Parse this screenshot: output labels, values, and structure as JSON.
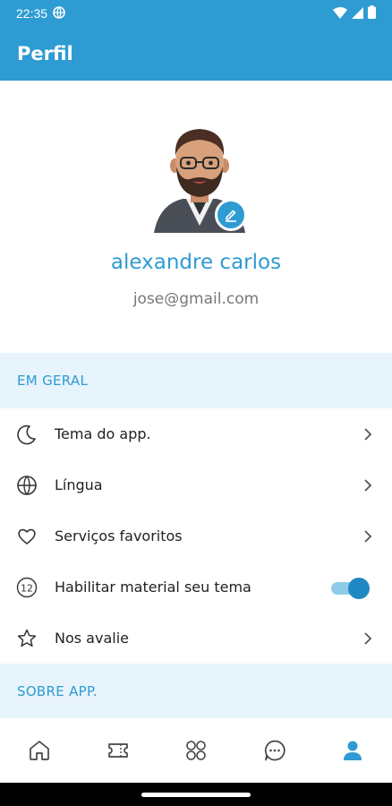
{
  "status_bar": {
    "time": "22:35",
    "icons": [
      "vpn-globe-icon",
      "wifi-icon",
      "signal-icon",
      "battery-icon"
    ]
  },
  "app_bar": {
    "title": "Perfil"
  },
  "profile": {
    "name": "alexandre carlos",
    "email": "jose@gmail.com",
    "avatar_icon": "avatar-memoji",
    "edit_icon": "pencil-icon"
  },
  "sections": {
    "general": {
      "label": "EM GERAL"
    },
    "about": {
      "label": "SOBRE APP."
    }
  },
  "menu": [
    {
      "label": "Tema do app.",
      "icon": "moon-icon",
      "trailing": "chevron"
    },
    {
      "label": "Língua",
      "icon": "globe-icon",
      "trailing": "chevron"
    },
    {
      "label": "Serviços favoritos",
      "icon": "heart-icon",
      "trailing": "chevron"
    },
    {
      "label": "Habilitar material seu tema",
      "icon": "android-12-icon",
      "trailing": "toggle",
      "toggle_on": true
    },
    {
      "label": "Nos avalie",
      "icon": "star-icon",
      "trailing": "chevron"
    }
  ],
  "bottom_nav": [
    {
      "icon": "home-icon",
      "active": false
    },
    {
      "icon": "ticket-icon",
      "active": false
    },
    {
      "icon": "grid-icon",
      "active": false
    },
    {
      "icon": "chat-icon",
      "active": false
    },
    {
      "icon": "profile-icon",
      "active": true
    }
  ],
  "colors": {
    "primary": "#2e9bd3",
    "section_bg": "#e7f4fb",
    "text": "#222222",
    "muted": "#777777",
    "inactive_icon": "#444444"
  }
}
